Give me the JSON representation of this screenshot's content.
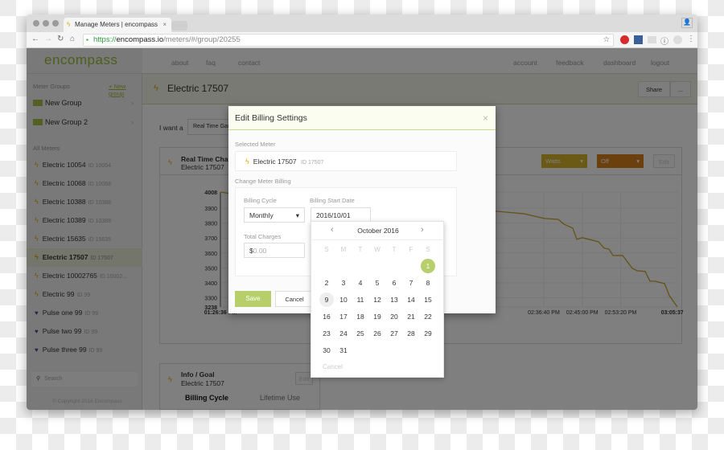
{
  "browser": {
    "tab_title": "Manage Meters | encompass",
    "url_scheme": "https://",
    "url_host": "encompass.io",
    "url_path": "/meters/#/group/20255"
  },
  "app": {
    "logo": "encompass",
    "nav_left": [
      "about",
      "faq",
      "contact"
    ],
    "nav_right": [
      "account",
      "feedback",
      "dashboard",
      "logout"
    ]
  },
  "sidebar": {
    "groups_heading": "Meter Groups",
    "new_group": "+ New group",
    "groups": [
      "New Group",
      "New Group 2"
    ],
    "all_meters_heading": "All Meters",
    "meters": [
      {
        "name": "Electric 10054",
        "id": "ID 10054",
        "type": "electric"
      },
      {
        "name": "Electric 10068",
        "id": "ID 10068",
        "type": "electric"
      },
      {
        "name": "Electric 10388",
        "id": "ID 10388",
        "type": "electric"
      },
      {
        "name": "Electric 10389",
        "id": "ID 10389",
        "type": "electric"
      },
      {
        "name": "Electric 15635",
        "id": "ID 15635",
        "type": "electric"
      },
      {
        "name": "Electric 17507",
        "id": "ID 17507",
        "type": "electric",
        "selected": true
      },
      {
        "name": "Electric 10002765",
        "id": "ID 10002...",
        "type": "electric"
      },
      {
        "name": "Electric 99",
        "id": "ID 99",
        "type": "electric"
      },
      {
        "name": "Pulse one 99",
        "id": "ID 99",
        "type": "pulse"
      },
      {
        "name": "Pulse two 99",
        "id": "ID 99",
        "type": "pulse"
      },
      {
        "name": "Pulse three 99",
        "id": "ID 99",
        "type": "pulse"
      }
    ],
    "search_placeholder": "Search",
    "copyright": "© Copyright 2016 Encompass"
  },
  "main": {
    "title": "Electric 17507",
    "share": "Share",
    "more": "...",
    "i_want_a": "I want a",
    "view_select": "Real Time Gau",
    "chart_card": {
      "title": "Real Time Char",
      "subtitle": "Electric 17507",
      "units": "Watts",
      "mode": "Off",
      "edit": "Edit",
      "units_color": "#d4b52a",
      "mode_color": "#d9801a"
    },
    "info_card": {
      "title": "Info / Goal",
      "subtitle": "Electric 17507",
      "edit": "Edit",
      "tab_billing": "Billing Cycle",
      "tab_lifetime": "Lifetime Use"
    }
  },
  "chart_data": {
    "type": "line",
    "color": "#c9a52a",
    "ylim": [
      3238,
      4008
    ],
    "xlim": [
      "01:26:36 PM",
      "03:05:37 PM"
    ],
    "yticks": [
      "4008",
      "3900",
      "3800",
      "3700",
      "3600",
      "3500",
      "3400",
      "3300",
      "3238"
    ],
    "xticks": [
      "01:26:36 PM",
      "02:36:40 PM",
      "02:45:00 PM",
      "02:53:20 PM",
      "03:05:37 PM"
    ],
    "points": [
      [
        "13:26:36",
        4008
      ],
      [
        "13:30:05",
        3992
      ],
      [
        "13:33:55",
        3997
      ],
      [
        "14:03:13",
        3943
      ],
      [
        "14:32:19",
        3863
      ],
      [
        "14:36:51",
        3831
      ],
      [
        "14:39:49",
        3825
      ],
      [
        "14:41:02",
        3793
      ],
      [
        "14:42:57",
        3766
      ],
      [
        "14:43:50",
        3691
      ],
      [
        "14:45:03",
        3702
      ],
      [
        "14:48:32",
        3675
      ],
      [
        "14:49:45",
        3632
      ],
      [
        "14:50:48",
        3626
      ],
      [
        "14:51:40",
        3583
      ],
      [
        "14:53:46",
        3583
      ],
      [
        "14:55:51",
        3497
      ],
      [
        "14:56:54",
        3481
      ],
      [
        "14:58:39",
        3476
      ],
      [
        "14:59:41",
        3411
      ],
      [
        "15:00:44",
        3411
      ],
      [
        "15:02:50",
        3395
      ],
      [
        "15:03:53",
        3314
      ],
      [
        "15:05:37",
        3238
      ]
    ]
  },
  "modal": {
    "title": "Edit Billing Settings",
    "close": "×",
    "selected_meter_label": "Selected Meter",
    "meter_name": "Electric 17507",
    "meter_id": "ID 17507",
    "change_label": "Change Meter Billing",
    "cycle_label": "Billing Cycle",
    "cycle_value": "Monthly",
    "start_label": "Billing Start Date",
    "start_value": "2016/10/01",
    "charges_label": "Total Charges",
    "currency": "$",
    "charges_placeholder": "0.00",
    "save": "Save",
    "cancel": "Cancel",
    "save_color": "#b6cf6b"
  },
  "datepicker": {
    "month": "October 2016",
    "prev": "‹",
    "next": "›",
    "weekdays": [
      "S",
      "M",
      "T",
      "W",
      "T",
      "F",
      "S"
    ],
    "weeks": [
      [
        "",
        "",
        "",
        "",
        "",
        "",
        "1"
      ],
      [
        "2",
        "3",
        "4",
        "5",
        "6",
        "7",
        "8"
      ],
      [
        "9",
        "10",
        "11",
        "12",
        "13",
        "14",
        "15"
      ],
      [
        "16",
        "17",
        "18",
        "19",
        "20",
        "21",
        "22"
      ],
      [
        "23",
        "24",
        "25",
        "26",
        "27",
        "28",
        "29"
      ],
      [
        "30",
        "31",
        "",
        "",
        "",
        "",
        ""
      ]
    ],
    "selected": "1",
    "today": "9",
    "cancel": "Cancel"
  }
}
